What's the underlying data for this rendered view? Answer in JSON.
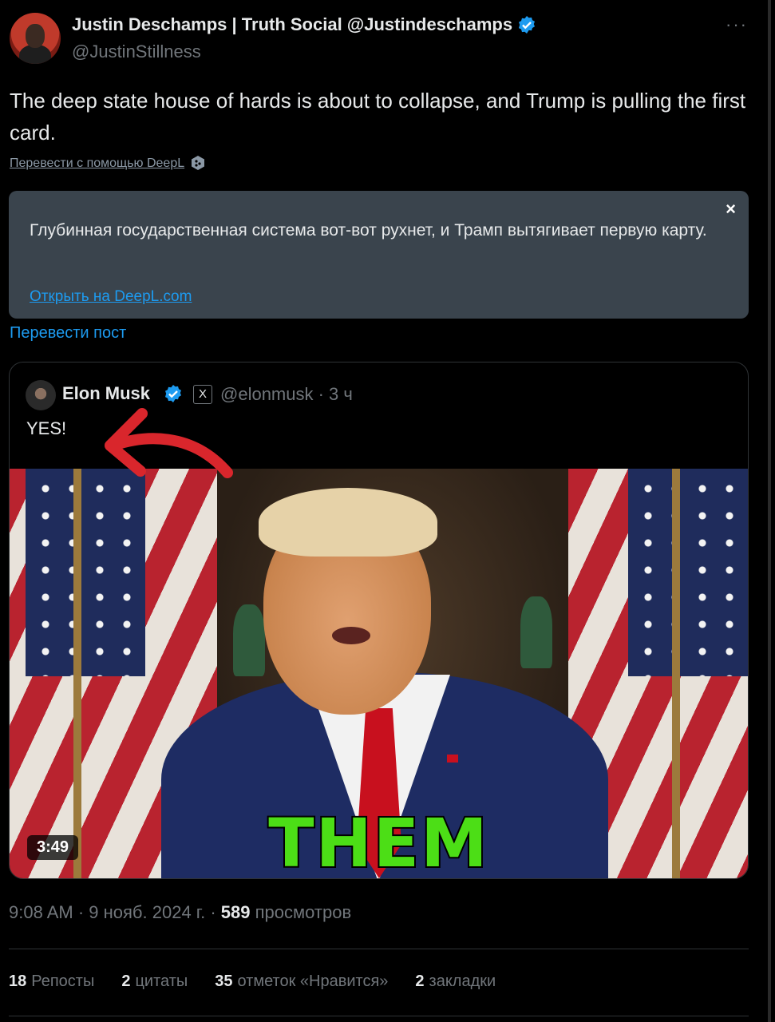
{
  "author": {
    "display_name": "Justin Deschamps | Truth Social @Justindeschamps",
    "handle": "@JustinStillness"
  },
  "tweet": {
    "text": "The deep state house of hards is about to  collapse, and Trump is pulling the first card.",
    "translate_with": "Перевести с помощью DeepL"
  },
  "translation": {
    "text": "Глубинная государственная система вот-вот рухнет, и Трамп вытягивает первую карту.",
    "open_link": "Открыть на DeepL.com",
    "close": "×"
  },
  "translate_post": "Перевести пост",
  "quote": {
    "name": "Elon Musk",
    "x_badge": "X",
    "handle_time": "@elonmusk · 3 ч",
    "text": "YES!",
    "video": {
      "caption": "THEM",
      "duration": "3:49"
    }
  },
  "meta": {
    "time_date": "9:08 AM · 9 нояб. 2024 г. · ",
    "views_count": "589",
    "views_label": "просмотров"
  },
  "stats": [
    {
      "count": "18",
      "label": "Репосты"
    },
    {
      "count": "2",
      "label": "цитаты"
    },
    {
      "count": "35",
      "label": "отметок «Нравится»"
    },
    {
      "count": "2",
      "label": "закладки"
    }
  ],
  "more": "···",
  "colors": {
    "background": "#000000",
    "accent": "#1d9bf0",
    "muted": "#71767b",
    "translation_bg": "#3a444d",
    "caption": "#4cde16",
    "arrow": "#d9262c"
  }
}
